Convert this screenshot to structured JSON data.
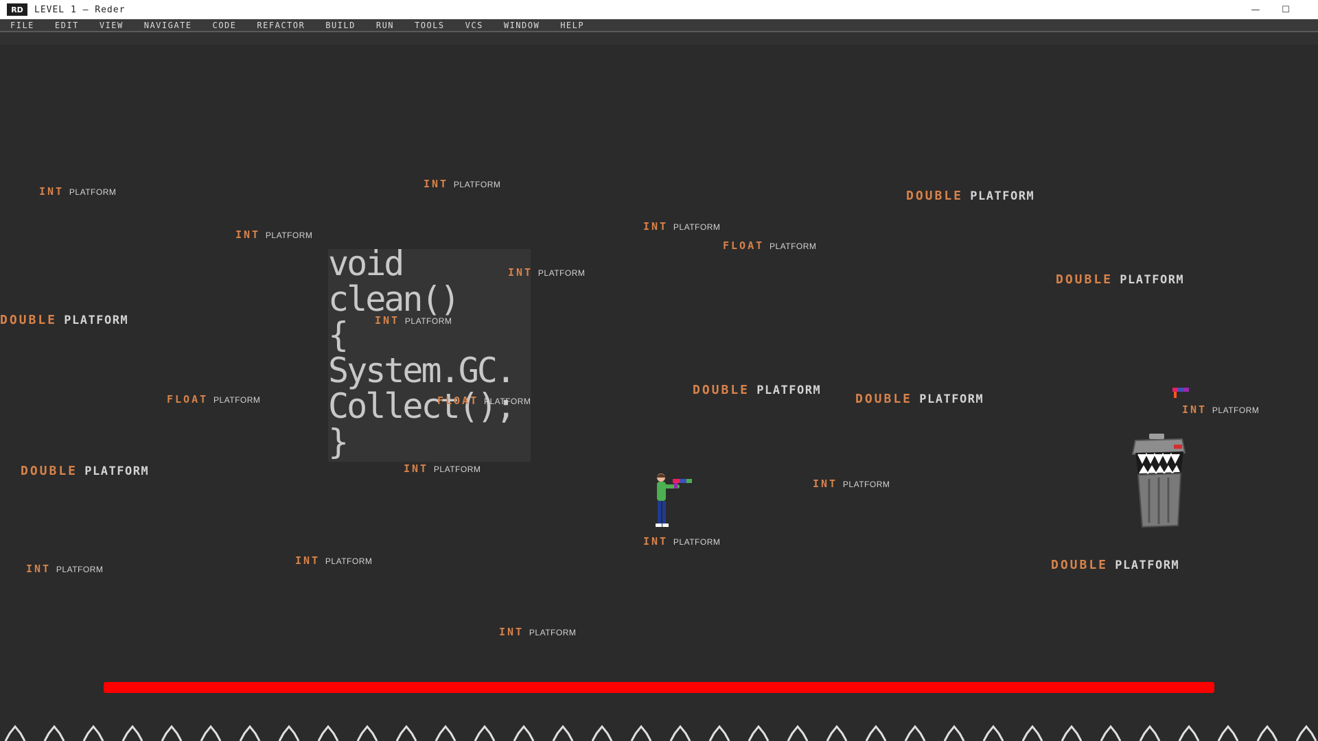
{
  "window": {
    "logo": "RD",
    "title": "LEVEL 1 – Reder",
    "minimize_glyph": "—",
    "maximize_glyph": "☐"
  },
  "menu": [
    "FILE",
    "EDIT",
    "VIEW",
    "NAVIGATE",
    "CODE",
    "REFACTOR",
    "BUILD",
    "RUN",
    "TOOLS",
    "VCS",
    "WINDOW",
    "HELP"
  ],
  "code_block": "void\nclean()\n{\nSystem.GC.\nCollect();\n}",
  "platforms": [
    {
      "type": "INT",
      "label": "PLATFORM"
    },
    {
      "type": "INT",
      "label": "PLATFORM"
    },
    {
      "type": "DOUBLE",
      "label": "PLATFORM"
    },
    {
      "type": "INT",
      "label": "PLATFORM"
    },
    {
      "type": "INT",
      "label": "PLATFORM"
    },
    {
      "type": "FLOAT",
      "label": "PLATFORM"
    },
    {
      "type": "DOUBLE",
      "label": "PLATFORM"
    },
    {
      "type": "INT",
      "label": "PLATFORM"
    },
    {
      "type": "DOUBLE",
      "label": "PLATFORM"
    },
    {
      "type": "INT",
      "label": "PLATFORM"
    },
    {
      "type": "FLOAT",
      "label": "PLATFORM"
    },
    {
      "type": "FLOAT",
      "label": "PLATFORM"
    },
    {
      "type": "DOUBLE",
      "label": "PLATFORM"
    },
    {
      "type": "DOUBLE",
      "label": "PLATFORM"
    },
    {
      "type": "INT",
      "label": "PLATFORM"
    },
    {
      "type": "DOUBLE",
      "label": "PLATFORM"
    },
    {
      "type": "INT",
      "label": "PLATFORM"
    },
    {
      "type": "INT",
      "label": "PLATFORM"
    },
    {
      "type": "INT",
      "label": "PLATFORM"
    },
    {
      "type": "DOUBLE",
      "label": "PLATFORM"
    },
    {
      "type": "INT",
      "label": "PLATFORM"
    },
    {
      "type": "INT",
      "label": "PLATFORM"
    },
    {
      "type": "INT",
      "label": "PLATFORM"
    }
  ],
  "health_bar": {
    "fill_fraction": 1.0,
    "color": "#ff0000"
  },
  "colors": {
    "background": "#2b2b2b",
    "keyword": "#d9834a",
    "platform_text": "#d4d4d4"
  }
}
